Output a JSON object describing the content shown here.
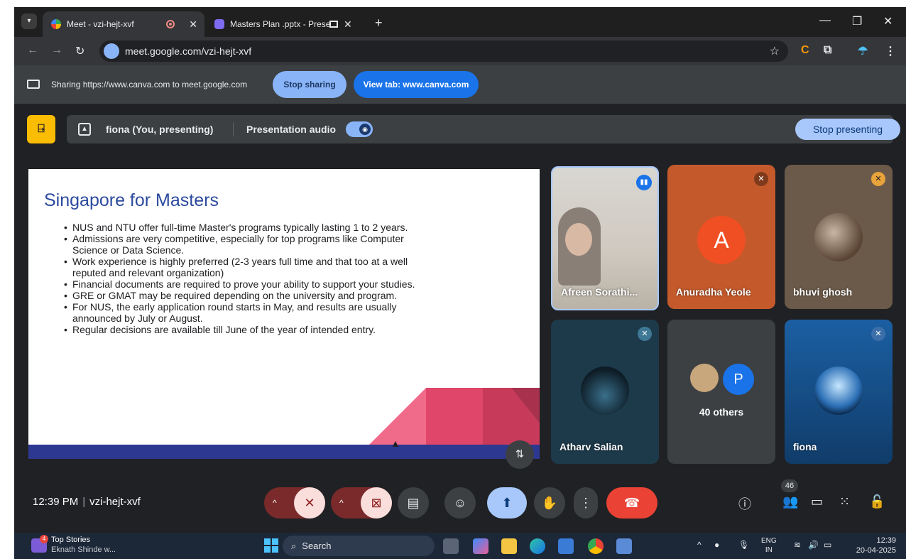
{
  "browser": {
    "tabs": [
      {
        "title": "Meet - vzi-hejt-xvf",
        "active": true
      },
      {
        "title": "Masters Plan .pptx - Presen",
        "active": false
      }
    ],
    "url": "meet.google.com/vzi-hejt-xvf"
  },
  "sharebar": {
    "text": "Sharing https://www.canva.com to meet.google.com",
    "stop_sharing": "Stop sharing",
    "view_tab": "View tab: www.canva.com"
  },
  "presenting": {
    "who": "fiona (You, presenting)",
    "audio_label": "Presentation audio",
    "audio_on": true,
    "stop_presenting": "Stop presenting"
  },
  "slide": {
    "title": "Singapore for Masters",
    "bullets": [
      "NUS and NTU offer full-time Master's programs typically lasting 1 to 2 years.",
      "Admissions are very competitive, especially for top programs like Computer Science or Data Science.",
      "Work experience is highly preferred (2-3 years full time and that too at a well reputed and relevant organization)",
      "Financial documents are required to prove your ability to support your studies.",
      "GRE or GMAT may be required depending on the university and program.",
      "For NUS, the early application round starts in May, and results are usually announced by July or August.",
      "Regular decisions are available till June of the year of intended entry."
    ]
  },
  "participants": [
    {
      "name": "Afreen Sorathi...",
      "speaking": true
    },
    {
      "name": "Anuradha Yeole",
      "initial": "A",
      "muted": true
    },
    {
      "name": "bhuvi ghosh",
      "muted": true
    },
    {
      "name": "Atharv Salian",
      "muted": true
    },
    {
      "name": "40 others",
      "initial": "P"
    },
    {
      "name": "fiona",
      "muted": true
    }
  ],
  "meeting": {
    "time": "12:39 PM",
    "code": "vzi-hejt-xvf",
    "people_count": "46"
  },
  "taskbar": {
    "news_title": "Top Stories",
    "news_sub": "Eknath Shinde w...",
    "news_badge": "4",
    "search": "Search",
    "lang1": "ENG",
    "lang2": "IN",
    "clock_time": "12:39",
    "clock_date": "20-04-2025"
  },
  "colors": {
    "accent": "#8ab4f8",
    "hangup": "#ea4335",
    "door": "#fbbc04",
    "slide_title": "#2c4a9e",
    "slide_band": "#2d3891"
  }
}
